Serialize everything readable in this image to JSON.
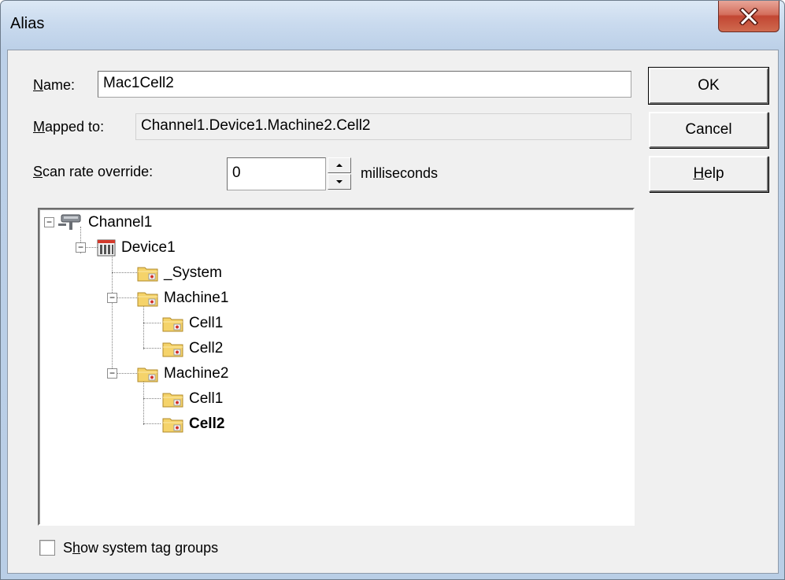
{
  "window": {
    "title": "Alias",
    "close_glyph": "X"
  },
  "form": {
    "name": {
      "label_prefix": "",
      "label_accel": "N",
      "label_rest": "ame:",
      "value": "Mac1Cell2"
    },
    "mapped": {
      "label_accel": "M",
      "label_rest": "apped to:",
      "value": "Channel1.Device1.Machine2.Cell2"
    },
    "scan": {
      "label_accel": "S",
      "label_rest": "can rate override:",
      "value": "0",
      "unit": "milliseconds"
    },
    "show_system": {
      "label_pre": "S",
      "label_accel": "h",
      "label_rest": "ow system tag groups",
      "checked": false
    }
  },
  "buttons": {
    "ok": "OK",
    "cancel": "Cancel",
    "help_accel": "H",
    "help_rest": "elp"
  },
  "tree": {
    "channel": "Channel1",
    "device": "Device1",
    "system": "_System",
    "machine1": "Machine1",
    "m1_cell1": "Cell1",
    "m1_cell2": "Cell2",
    "machine2": "Machine2",
    "m2_cell1": "Cell1",
    "m2_cell2": "Cell2",
    "selected": "Cell2"
  },
  "icons": {
    "channel": "network-channel-icon",
    "device": "device-icon",
    "folder": "tag-group-folder-icon"
  },
  "colors": {
    "close_button": "#c24632",
    "folder_fill": "#f5d36a",
    "folder_dot": "#d0322a"
  }
}
